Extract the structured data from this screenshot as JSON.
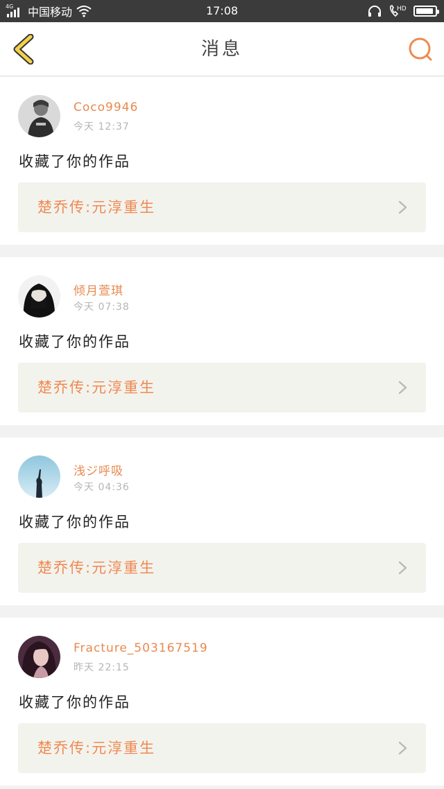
{
  "status_bar": {
    "network": "4G",
    "carrier": "中国移动",
    "time": "17:08",
    "hd": "HD"
  },
  "header": {
    "title": "消息"
  },
  "colors": {
    "accent": "#ef8950",
    "back_icon_fill": "#f3d14a",
    "work_bg": "#f3f3ee"
  },
  "messages": [
    {
      "user": "Coco9946",
      "time": "今天 12:37",
      "action": "收藏了你的作品",
      "work": "楚乔传:元淳重生",
      "avatar_icon": "avatar-photo"
    },
    {
      "user": "倾月萱琪",
      "time": "今天 07:38",
      "action": "收藏了你的作品",
      "work": "楚乔传:元淳重生",
      "avatar_icon": "avatar-photo"
    },
    {
      "user": "浅ジ呼吸",
      "time": "今天 04:36",
      "action": "收藏了你的作品",
      "work": "楚乔传:元淳重生",
      "avatar_icon": "avatar-photo"
    },
    {
      "user": "Fracture_503167519",
      "time": "昨天 22:15",
      "action": "收藏了你的作品",
      "work": "楚乔传:元淳重生",
      "avatar_icon": "avatar-photo"
    }
  ]
}
